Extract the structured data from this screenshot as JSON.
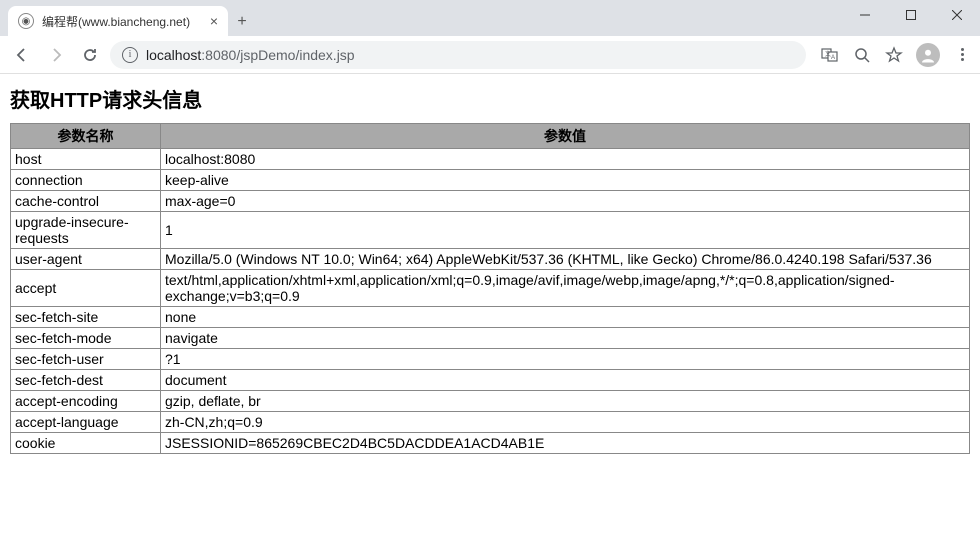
{
  "browser": {
    "tab_title": "编程帮(www.biancheng.net)",
    "url_host": "localhost",
    "url_port": ":8080",
    "url_path": "/jspDemo/index.jsp"
  },
  "page": {
    "heading": "获取HTTP请求头信息",
    "col_name": "参数名称",
    "col_value": "参数值",
    "rows": [
      {
        "name": "host",
        "value": "localhost:8080"
      },
      {
        "name": "connection",
        "value": "keep-alive"
      },
      {
        "name": "cache-control",
        "value": "max-age=0"
      },
      {
        "name": "upgrade-insecure-requests",
        "value": "1"
      },
      {
        "name": "user-agent",
        "value": "Mozilla/5.0 (Windows NT 10.0; Win64; x64) AppleWebKit/537.36 (KHTML, like Gecko) Chrome/86.0.4240.198 Safari/537.36"
      },
      {
        "name": "accept",
        "value": "text/html,application/xhtml+xml,application/xml;q=0.9,image/avif,image/webp,image/apng,*/*;q=0.8,application/signed-exchange;v=b3;q=0.9"
      },
      {
        "name": "sec-fetch-site",
        "value": "none"
      },
      {
        "name": "sec-fetch-mode",
        "value": "navigate"
      },
      {
        "name": "sec-fetch-user",
        "value": "?1"
      },
      {
        "name": "sec-fetch-dest",
        "value": "document"
      },
      {
        "name": "accept-encoding",
        "value": "gzip, deflate, br"
      },
      {
        "name": "accept-language",
        "value": "zh-CN,zh;q=0.9"
      },
      {
        "name": "cookie",
        "value": "JSESSIONID=865269CBEC2D4BC5DACDDEA1ACD4AB1E"
      }
    ]
  }
}
